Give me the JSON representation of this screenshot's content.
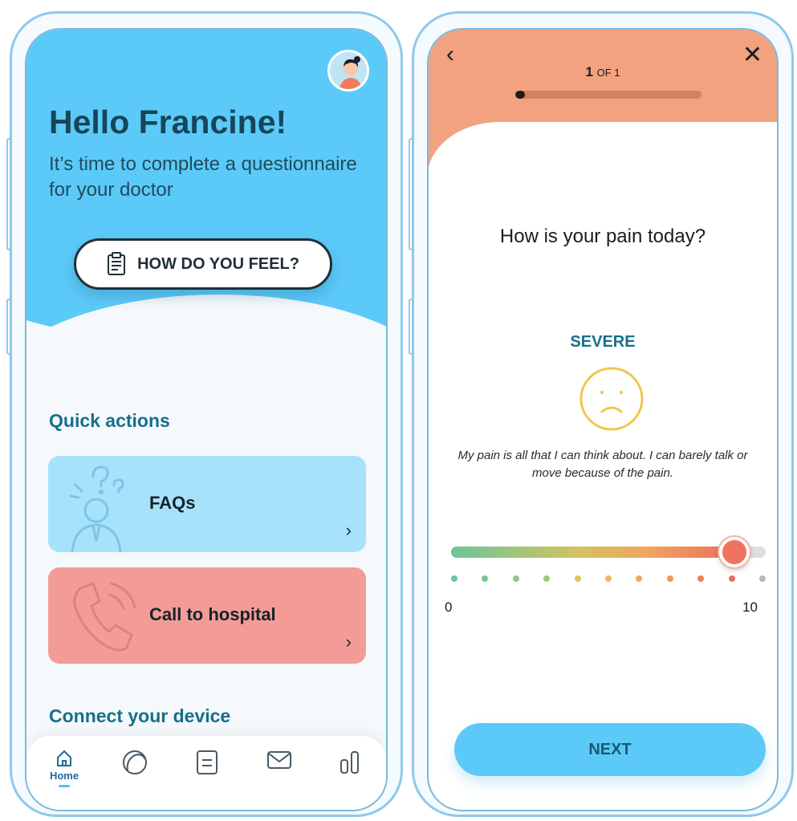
{
  "home": {
    "greeting": "Hello Francine!",
    "subtitle": "It’s time to complete a questionnaire for your doctor",
    "cta_label": "HOW DO YOU FEEL?",
    "quick_actions_title": "Quick actions",
    "cards": [
      {
        "label": "FAQs",
        "color": "#a7e2fb"
      },
      {
        "label": "Call to hospital",
        "color": "#f39c97"
      }
    ],
    "connect_title": "Connect your device",
    "tabs": [
      {
        "label": "Home",
        "icon": "home-icon",
        "active": true
      },
      {
        "label": "",
        "icon": "circle-icon"
      },
      {
        "label": "",
        "icon": "list-icon"
      },
      {
        "label": "",
        "icon": "mail-icon"
      },
      {
        "label": "",
        "icon": "chart-icon"
      }
    ],
    "accent": "#5ccaf8"
  },
  "questionnaire": {
    "step_current": "1",
    "step_total": "OF 1",
    "progress": 0.05,
    "question": "How is your pain today?",
    "level_label": "SEVERE",
    "description": "My pain is all that I can think about. I can barely talk or move because of the pain.",
    "slider_value": 9,
    "scale_min": "0",
    "scale_max": "10",
    "tick_colors": [
      "#6cc59b",
      "#7dc494",
      "#8fc48c",
      "#a6c47e",
      "#e6c15a",
      "#f0b85c",
      "#f0a860",
      "#ef9563",
      "#ee7f60",
      "#ee6a5c",
      "#b8b8b8"
    ],
    "next_label": "NEXT",
    "header_color": "#f2a27e"
  }
}
